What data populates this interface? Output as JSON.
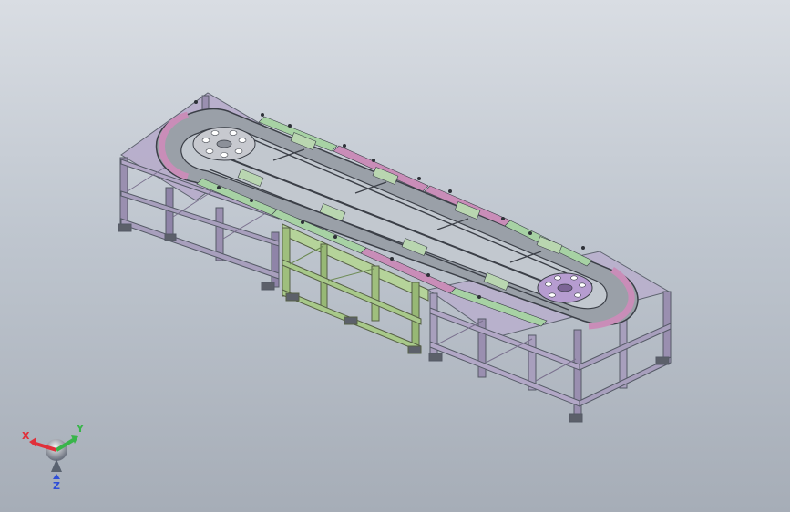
{
  "viewport": {
    "type": "cad-isometric-view",
    "subject": "chain-conveyor-assembly"
  },
  "triad": {
    "x_label": "X",
    "y_label": "Y",
    "z_label": "Z",
    "colors": {
      "x": "#e0303a",
      "y": "#39b54a",
      "z": "#2f4fd8"
    }
  },
  "colors": {
    "frame_left": "#9a8fb0",
    "frame_mid": "#9fbf7d",
    "frame_right": "#a89fbd",
    "track_pink": "#c98db8",
    "track_green": "#a7d2a4",
    "chain_dark": "#3b3f47",
    "disc_left": "#c7c9cf",
    "disc_right": "#b69cd0"
  }
}
